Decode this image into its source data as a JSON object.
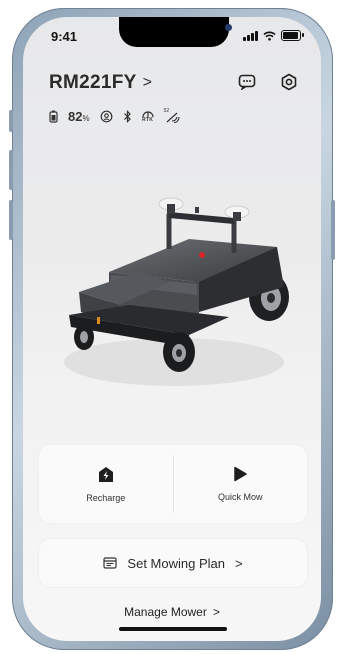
{
  "status_bar": {
    "time": "9:41"
  },
  "header": {
    "device_name": "RM221FY",
    "chevron": ">"
  },
  "status": {
    "battery_percent": "82",
    "battery_unit": "%",
    "rtk_label": "RTK",
    "signal_label": "52"
  },
  "actions": {
    "recharge_label": "Recharge",
    "quick_mow_label": "Quick Mow"
  },
  "plan": {
    "label": "Set Mowing Plan",
    "chevron": ">"
  },
  "manage": {
    "label": "Manage Mower",
    "chevron": ">"
  },
  "colors": {
    "accent_red": "#d7262a",
    "body_dark": "#3b3d40",
    "text": "#2b2b2b"
  }
}
